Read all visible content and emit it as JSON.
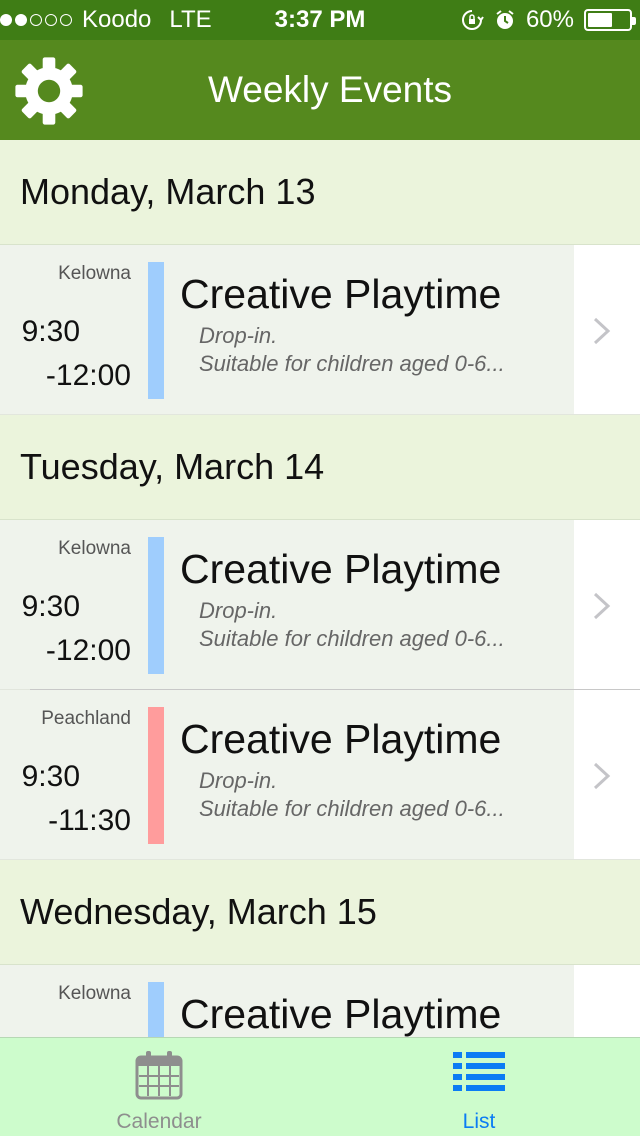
{
  "status_bar": {
    "carrier": "Koodo",
    "network": "LTE",
    "time": "3:37 PM",
    "battery": "60%",
    "battery_level": 0.6,
    "signal_bars_filled": 2,
    "signal_bars_total": 5
  },
  "nav": {
    "title": "Weekly Events",
    "settings_icon": "gear-icon"
  },
  "sections": [
    {
      "date": "Monday, March 13",
      "events": [
        {
          "location": "Kelowna",
          "start": "9:30",
          "end": "-12:00",
          "title": "Creative Playtime",
          "desc1": "Drop-in.",
          "desc2": "Suitable for children aged 0-6...",
          "color": "#9fcdfd"
        }
      ]
    },
    {
      "date": "Tuesday, March 14",
      "events": [
        {
          "location": "Kelowna",
          "start": "9:30",
          "end": "-12:00",
          "title": "Creative Playtime",
          "desc1": "Drop-in.",
          "desc2": "Suitable for children aged 0-6...",
          "color": "#9fcdfd"
        },
        {
          "location": "Peachland",
          "start": "9:30",
          "end": "-11:30",
          "title": "Creative Playtime",
          "desc1": "Drop-in.",
          "desc2": "Suitable for children aged 0-6...",
          "color": "#ff9c9c"
        }
      ]
    },
    {
      "date": "Wednesday, March 15",
      "events": [
        {
          "location": "Kelowna",
          "start": "",
          "end": "",
          "title": "Creative Playtime",
          "desc1": "",
          "desc2": "",
          "color": "#9fcdfd"
        }
      ]
    }
  ],
  "tabs": [
    {
      "label": "Calendar",
      "icon": "calendar-icon",
      "active": false
    },
    {
      "label": "List",
      "icon": "list-icon",
      "active": true
    }
  ],
  "colors": {
    "status_bar_bg": "#3f7d15",
    "nav_bg": "#55891e",
    "section_bg": "#ebf4dc",
    "tabbar_bg": "#cdfccc",
    "tab_active": "#0b7cf4",
    "tab_inactive": "#8e8e8e"
  }
}
